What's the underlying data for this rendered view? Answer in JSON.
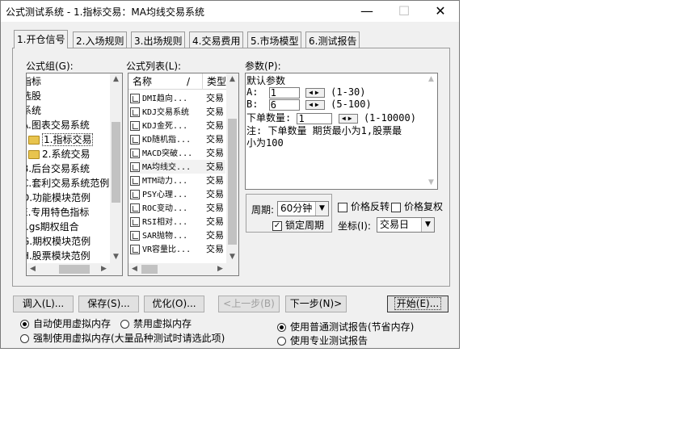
{
  "window": {
    "title": "公式测试系统 - 1.指标交易：MA均线交易系统",
    "minimize": "—",
    "maximize": "☐",
    "close": "✕"
  },
  "tabs": [
    {
      "label": "1.开仓信号",
      "active": true
    },
    {
      "label": "2.入场规则"
    },
    {
      "label": "3.出场规则"
    },
    {
      "label": "4.交易费用"
    },
    {
      "label": "5.市场模型"
    },
    {
      "label": "6.测试报告"
    }
  ],
  "formula_group": {
    "label": "公式组(G):",
    "items": [
      {
        "label": "指标"
      },
      {
        "label": "选股"
      },
      {
        "label": "系统"
      },
      {
        "label": "A.图表交易系统"
      },
      {
        "label": "1.指标交易",
        "folder": true,
        "selected": true
      },
      {
        "label": "2.系统交易",
        "folder": true
      },
      {
        "label": "B.后台交易系统"
      },
      {
        "label": "C.套利交易系统范例"
      },
      {
        "label": "D.功能模块范例"
      },
      {
        "label": "E.专用特色指标"
      },
      {
        "label": "F.gs期权组合"
      },
      {
        "label": "G.期权模块范例"
      },
      {
        "label": "H.股票模块范例"
      }
    ]
  },
  "formula_list": {
    "label": "公式列表(L):",
    "col_name": "名称",
    "col_sep": "/",
    "col_type": "类型",
    "items": [
      {
        "name": "DMI趋向...",
        "type": "交易"
      },
      {
        "name": "KDJ交易系统",
        "type": "交易"
      },
      {
        "name": "KDJ金死...",
        "type": "交易"
      },
      {
        "name": "KD随机指...",
        "type": "交易"
      },
      {
        "name": "MACD突破...",
        "type": "交易"
      },
      {
        "name": "MA均线交...",
        "type": "交易"
      },
      {
        "name": "MTM动力...",
        "type": "交易"
      },
      {
        "name": "PSY心理...",
        "type": "交易"
      },
      {
        "name": "ROC变动...",
        "type": "交易"
      },
      {
        "name": "RSI相对...",
        "type": "交易"
      },
      {
        "name": "SAR抛物...",
        "type": "交易"
      },
      {
        "name": "VR容量比...",
        "type": "交易"
      }
    ]
  },
  "params": {
    "label": "参数(P):",
    "heading": "默认参数",
    "a_label": "A:",
    "a_value": "1",
    "a_range": "(1-30)",
    "b_label": "B:",
    "b_value": "6",
    "b_range": "(5-100)",
    "qty_label": "下单数量:",
    "qty_value": "1",
    "qty_range": "(1-10000)",
    "note_line1": "注: 下单数量 期货最小为1,股票最",
    "note_line2": "小为100"
  },
  "period": {
    "label": "周期:",
    "value": "60分钟",
    "lock_label": "锁定周期",
    "lock_checked": true
  },
  "price_reverse_label": "价格反转",
  "price_restore_label": "价格复权",
  "coord": {
    "label": "坐标(I):",
    "value": "交易日"
  },
  "buttons": {
    "load": "调入(L)...",
    "save": "保存(S)...",
    "optimize": "优化(O)...",
    "prev": "<上一步(B)",
    "next": "下一步(N)>",
    "start": "开始(E)..."
  },
  "memory": {
    "auto": "自动使用虚拟内存",
    "disable": "禁用虚拟内存",
    "force": "强制使用虚拟内存(大量品种测试时请选此项)"
  },
  "report": {
    "normal": "使用普通测试报告(节省内存)",
    "pro": "使用专业测试报告"
  }
}
